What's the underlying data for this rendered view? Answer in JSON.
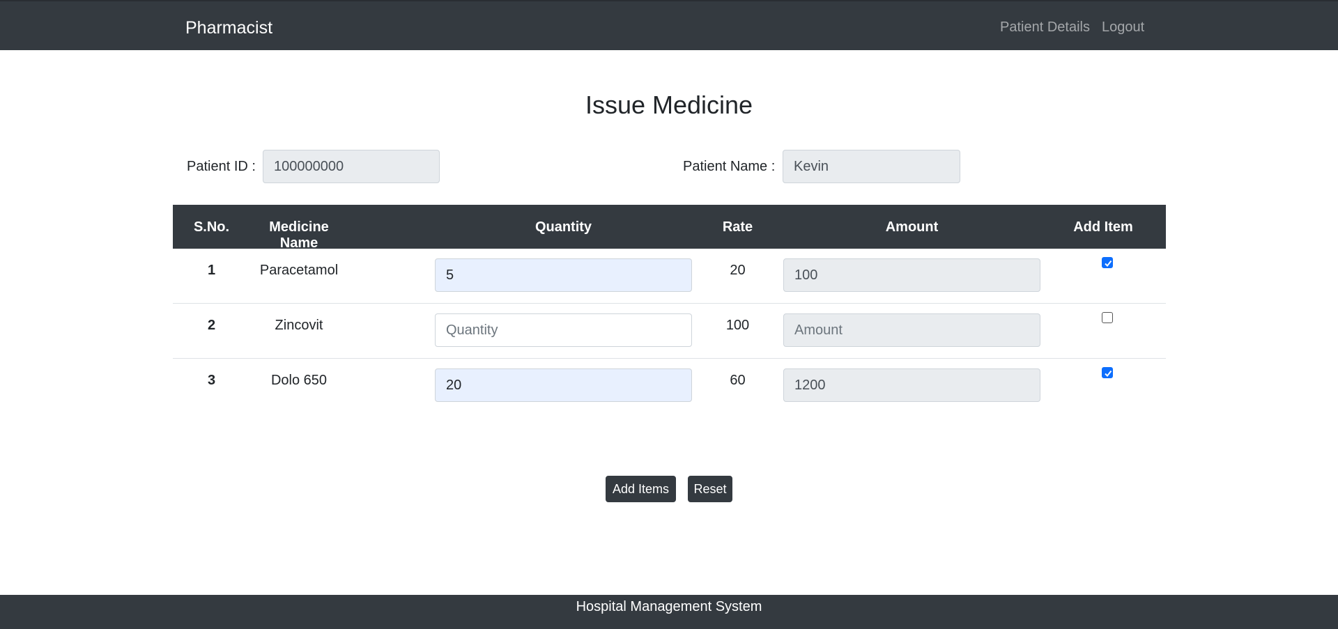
{
  "navbar": {
    "brand": "Pharmacist",
    "links": [
      "Patient Details",
      "Logout"
    ]
  },
  "page": {
    "title": "Issue Medicine"
  },
  "patient": {
    "id_label": "Patient ID :",
    "id_value": "100000000",
    "name_label": "Patient Name :",
    "name_value": "Kevin"
  },
  "table": {
    "headers": [
      "S.No.",
      "Medicine Name",
      "Quantity",
      "Rate",
      "Amount",
      "Add Item"
    ],
    "rows": [
      {
        "sno": "1",
        "medicine": "Paracetamol",
        "quantity": "5",
        "rate": "20",
        "amount": "100",
        "checked": true
      },
      {
        "sno": "2",
        "medicine": "Zincovit",
        "quantity": "",
        "rate": "100",
        "amount": "",
        "checked": false
      },
      {
        "sno": "3",
        "medicine": "Dolo 650",
        "quantity": "20",
        "rate": "60",
        "amount": "1200",
        "checked": true
      }
    ],
    "quantity_placeholder": "Quantity",
    "amount_placeholder": "Amount"
  },
  "buttons": {
    "add": "Add Items",
    "reset": "Reset"
  },
  "footer": {
    "text": "Hospital Management System"
  },
  "colors": {
    "dark": "#343a40",
    "checkbox": "#0d6efd",
    "autofill": "#e8f0fe"
  }
}
